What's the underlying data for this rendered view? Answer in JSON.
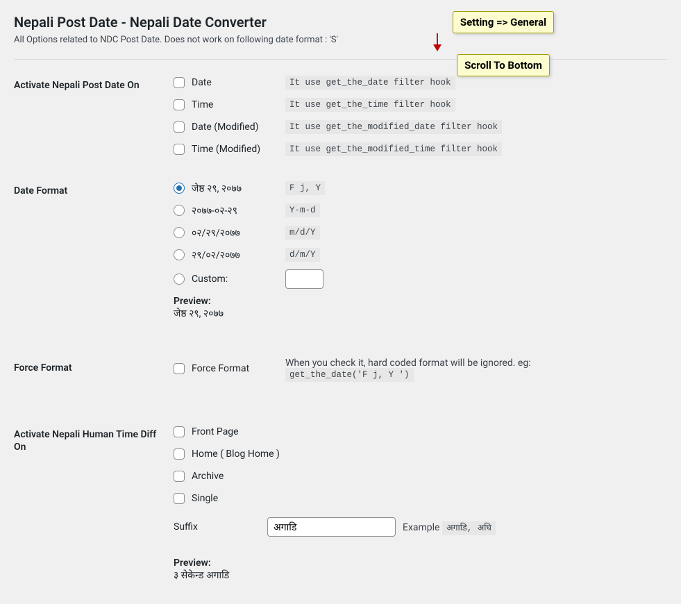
{
  "header": {
    "title": "Nepali Post Date - Nepali Date Converter",
    "description": "All Options related to NDC Post Date. Does not work on following date format : 'S'"
  },
  "callouts": {
    "top": "Setting => General",
    "bottom": "Scroll To Bottom"
  },
  "sections": {
    "activate_post_date": {
      "heading": "Activate Nepali Post Date On",
      "options": [
        {
          "label": "Date",
          "hint": "It use get_the_date filter hook"
        },
        {
          "label": "Time",
          "hint": "It use get_the_time filter hook"
        },
        {
          "label": "Date (Modified)",
          "hint": "It use get_the_modified_date filter hook"
        },
        {
          "label": "Time (Modified)",
          "hint": "It use get_the_modified_time filter hook"
        }
      ]
    },
    "date_format": {
      "heading": "Date Format",
      "options": [
        {
          "label": "जेष्ठ २९, २०७७",
          "hint": "F j, Y",
          "checked": true
        },
        {
          "label": "२०७७-०२-२९",
          "hint": "Y-m-d",
          "checked": false
        },
        {
          "label": "०२/२९/२०७७",
          "hint": "m/d/Y",
          "checked": false
        },
        {
          "label": "२९/०२/२०७७",
          "hint": "d/m/Y",
          "checked": false
        }
      ],
      "custom_label": "Custom:",
      "custom_value": "",
      "preview_label": "Preview:",
      "preview_value": "जेष्ठ २९, २०७७"
    },
    "force_format": {
      "heading": "Force Format",
      "label": "Force Format",
      "desc_prefix": "When you check it, hard coded format will be ignored. eg: ",
      "desc_code": "get_the_date('F j, Y ')"
    },
    "human_time_diff": {
      "heading": "Activate Nepali Human Time Diff On",
      "options": [
        {
          "label": "Front Page"
        },
        {
          "label": "Home ( Blog Home )"
        },
        {
          "label": "Archive"
        },
        {
          "label": "Single"
        }
      ],
      "suffix_label": "Suffix",
      "suffix_value": "अगाडि",
      "example_prefix": "Example ",
      "example_code": "अगाडि, अघि",
      "preview_label": "Preview:",
      "preview_value": "३ सेकेन्ड अगाडि"
    }
  }
}
